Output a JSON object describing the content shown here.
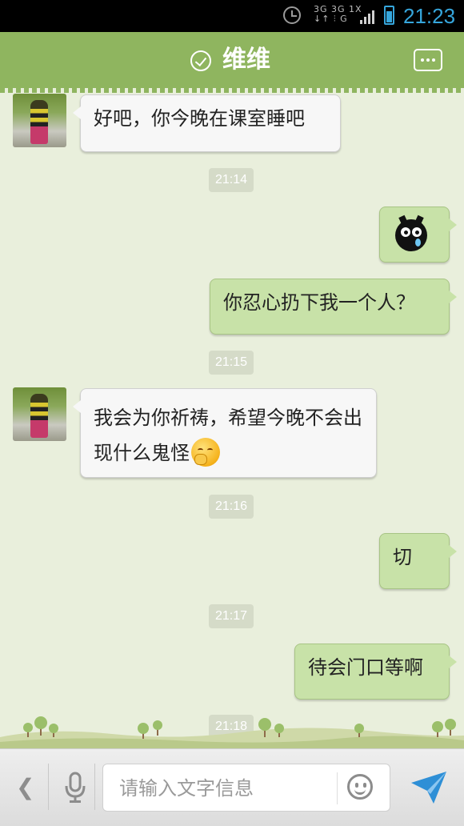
{
  "status_bar": {
    "network_text_1": "3G 3G 1X",
    "network_text_2": "↓↑ ⫶ G",
    "time": "21:23"
  },
  "header": {
    "title": "维维"
  },
  "messages": [
    {
      "side": "left",
      "text": "好吧，你今晚在课室睡吧"
    },
    {
      "timestamp": "21:14"
    },
    {
      "side": "right",
      "sticker": "crying-face-sticker"
    },
    {
      "side": "right",
      "text": "你忍心扔下我一个人？"
    },
    {
      "timestamp": "21:15"
    },
    {
      "side": "left",
      "text": "我会为你祈祷，希望今晚不会出现什么鬼怪",
      "emoji": "shy-face-emoji"
    },
    {
      "timestamp": "21:16"
    },
    {
      "side": "right",
      "text": "切"
    },
    {
      "timestamp": "21:17"
    },
    {
      "side": "right",
      "text": "待会门口等啊"
    },
    {
      "timestamp": "21:18"
    }
  ],
  "input_bar": {
    "placeholder": "请输入文字信息"
  },
  "colors": {
    "header_green": "#8fb55f",
    "chat_background": "#e9efdc",
    "outgoing_bubble": "#c8e2a8",
    "incoming_bubble": "#f7f7f7",
    "status_time_blue": "#36a6dc",
    "send_icon_blue": "#2e8fd6"
  }
}
